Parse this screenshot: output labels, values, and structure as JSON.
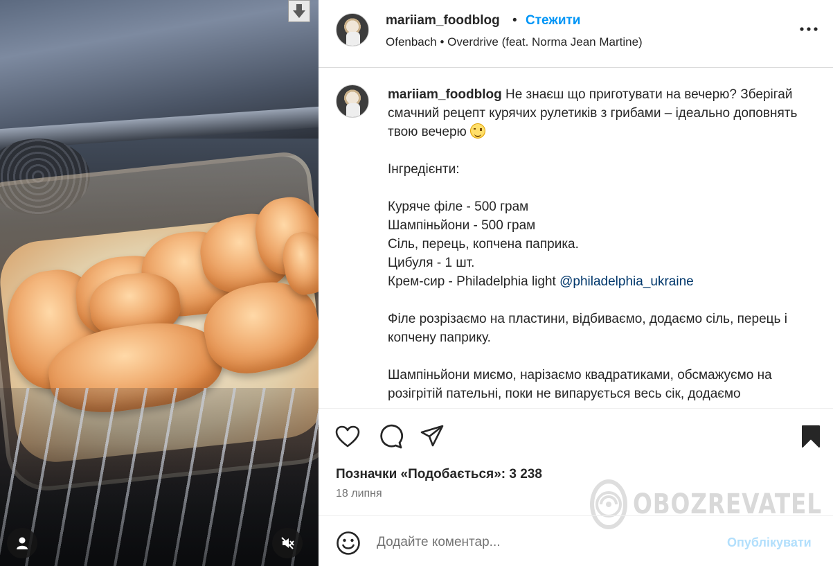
{
  "post": {
    "username": "mariiam_foodblog",
    "separator": "•",
    "follow_label": "Стежити",
    "music": {
      "artist": "Ofenbach",
      "separator": "•",
      "track": "Overdrive (feat. Norma Jean Martine)"
    }
  },
  "caption": {
    "username": "mariiam_foodblog",
    "intro_text": "Не знаєш що приготувати на вечерю? Зберігай смачний рецепт курячих рулетиків з грибами – ідеально доповнять твою вечерю",
    "intro_emoji": "smiling-face-emoji",
    "ingredients_header": "Інгредієнти:",
    "ingredients": [
      "Куряче філе - 500 грам",
      "Шампіньйони - 500 грам",
      "Сіль, перець, копчена паприка.",
      "Цибуля - 1 шт."
    ],
    "cream_cheese_text": "Крем-сир - Philadelphia light",
    "mention": "@philadelphia_ukraine",
    "step_1": "Філе розрізаємо на пластини, відбиваємо, додаємо сіль, перець і копчену паприку.",
    "step_2": "Шампіньйони миємо, нарізаємо квадратиками, обсмажуємо на розігрітій пательні, поки не випарується весь сік, додаємо"
  },
  "engagement": {
    "likes_label": "Позначки «Подобається»: 3 238",
    "date": "18 липня"
  },
  "comment_bar": {
    "placeholder": "Додайте коментар...",
    "publish_label": "Опублікувати"
  },
  "watermark": {
    "text": "OBOZREVATEL"
  },
  "icons": {
    "media": [
      "download-icon",
      "user-tag-icon",
      "mute-icon"
    ],
    "header": [
      "more-options-icon"
    ],
    "actions": [
      "heart-icon",
      "comment-icon",
      "share-icon",
      "bookmark-icon"
    ],
    "comment": [
      "emoji-icon"
    ]
  },
  "colors": {
    "accent": "#0095f6",
    "text": "#262626",
    "secondary_text": "#737373",
    "mention": "#00376b",
    "publish_disabled": "#b2dffc",
    "divider": "#dbdbdb"
  }
}
